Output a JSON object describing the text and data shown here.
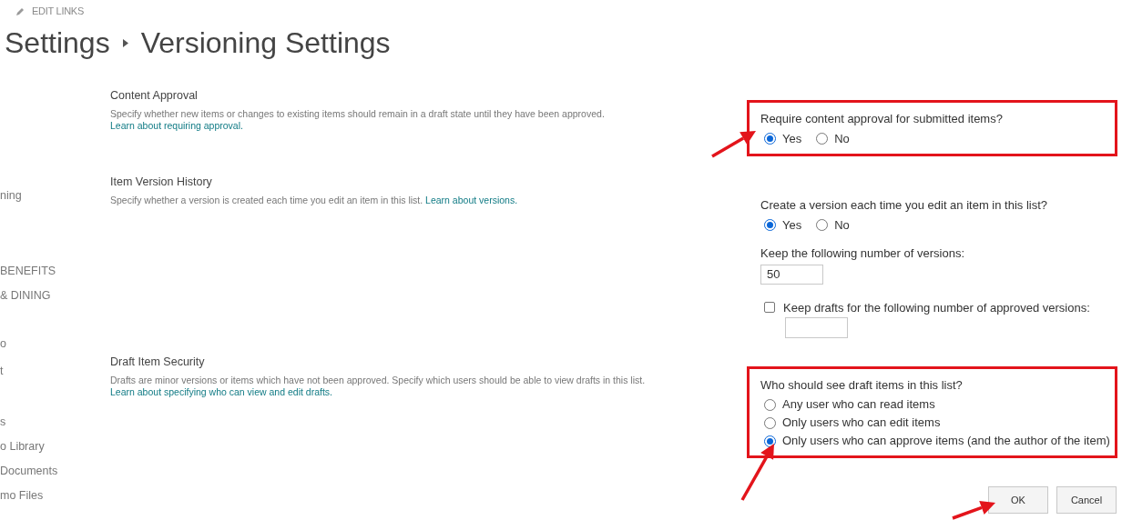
{
  "top_link": {
    "label": "EDIT LINKS"
  },
  "breadcrumb": [
    {
      "label": "Settings"
    },
    {
      "label": "Versioning Settings"
    }
  ],
  "sidebar": {
    "items": [
      {
        "label": "ning"
      },
      {
        "label": "BENEFITS"
      },
      {
        "label": "& DINING"
      },
      {
        "label": "o"
      },
      {
        "label": "t"
      },
      {
        "label": "s"
      },
      {
        "label": "o Library"
      },
      {
        "label": "Documents"
      },
      {
        "label": "mo Files"
      }
    ]
  },
  "sections": [
    {
      "title": "Content Approval",
      "description": "Specify whether new items or changes to existing items should remain in a draft state until they have been approved.",
      "link": "Learn about requiring approval.",
      "highlighted": true,
      "arrow": true,
      "fields": [
        {
          "kind": "radio_inline",
          "label": "Require content approval for submitted items?",
          "options": [
            {
              "label": "Yes",
              "selected": true
            },
            {
              "label": "No",
              "selected": false
            }
          ]
        }
      ]
    },
    {
      "title": "Item Version History",
      "description": "Specify whether a version is created each time you edit an item in this list.",
      "link": "Learn about versions.",
      "highlighted": false,
      "arrow": false,
      "fields": [
        {
          "kind": "radio_inline",
          "label": "Create a version each time you edit an item in this list?",
          "options": [
            {
              "label": "Yes",
              "selected": true
            },
            {
              "label": "No",
              "selected": false
            }
          ]
        },
        {
          "kind": "number",
          "label": "Keep the following number of versions:",
          "value": "50"
        },
        {
          "kind": "checkbox_number",
          "label": "Keep drafts for the following number of approved versions:",
          "checked": false
        }
      ]
    },
    {
      "title": "Draft Item Security",
      "description": "Drafts are minor versions or items which have not been approved. Specify which users should be able to view drafts in this list.",
      "link": "Learn about specifying who can view and edit drafts.",
      "highlighted": true,
      "arrow": true,
      "fields": [
        {
          "kind": "radio_list",
          "label": "Who should see draft items in this list?",
          "options": [
            {
              "label": "Any user who can read items",
              "selected": false
            },
            {
              "label": "Only users who can edit items",
              "selected": false
            },
            {
              "label": "Only users who can approve items (and the author of the item)",
              "selected": true
            }
          ]
        }
      ]
    }
  ],
  "buttons": [
    {
      "label": "OK",
      "arrow": true
    },
    {
      "label": "Cancel",
      "arrow": false
    }
  ]
}
